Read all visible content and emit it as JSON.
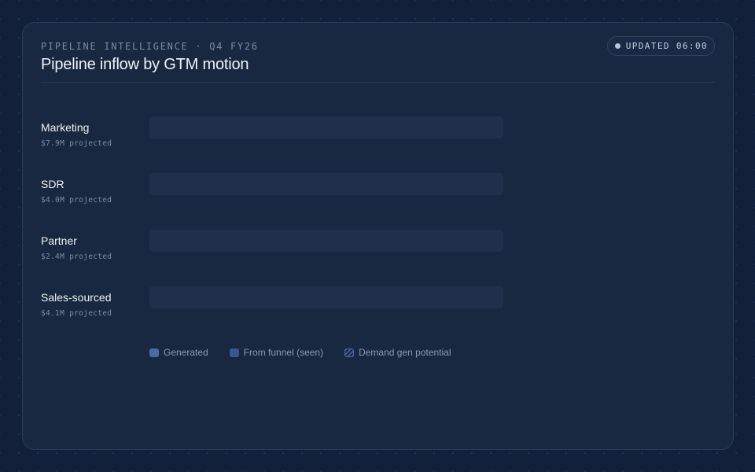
{
  "header": {
    "eyebrow": "PIPELINE INTELLIGENCE · Q4 FY26",
    "title": "Pipeline inflow by GTM motion",
    "badge": "UPDATED 06:00"
  },
  "chart_data": {
    "type": "bar",
    "orientation": "horizontal",
    "stacked": true,
    "title": "Pipeline inflow by GTM motion",
    "categories": [
      "Marketing",
      "SDR",
      "Partner",
      "Sales-sourced"
    ],
    "subtitles": [
      "$7.9M projected",
      "$4.0M projected",
      "$2.4M projected",
      "$4.1M projected"
    ],
    "series": [
      {
        "name": "Generated",
        "values": [
          0,
          0,
          0,
          0
        ],
        "color": "#4a6aa3"
      },
      {
        "name": "From funnel (seen)",
        "values": [
          0,
          0,
          0,
          0
        ],
        "color": "#3b5790"
      },
      {
        "name": "Demand gen potential",
        "values": [
          0,
          0,
          0,
          0
        ],
        "color": "#4d6ba4",
        "pattern": "hatched"
      }
    ],
    "xlim": [
      0,
      8
    ],
    "grid": false,
    "legend_position": "bottom"
  },
  "colors": {
    "background": "#12203a",
    "card": "#182840",
    "track": "#1f304a",
    "text": "#eef2f8",
    "muted": "#7d8ba3"
  },
  "icons": {
    "badge_status": "status-dot-icon"
  }
}
